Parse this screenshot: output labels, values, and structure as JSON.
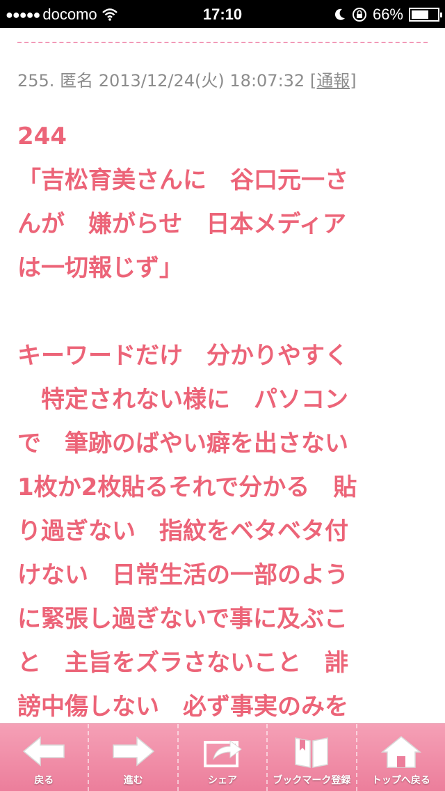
{
  "status_bar": {
    "signal": "●●●●●",
    "carrier": "docomo",
    "time": "17:10",
    "battery": "66%",
    "icons": [
      "wifi-icon",
      "moon-icon",
      "rotation-lock-icon",
      "battery-icon"
    ]
  },
  "post": {
    "number": "255.",
    "author": "匿名",
    "date": "2013/12/24(火) 18:07:32",
    "report_label": "[通報]",
    "lines": [
      "244",
      "「吉松育美さんに　谷口元一さ",
      "んが　嫌がらせ　日本メディア",
      "は一切報じず」",
      "",
      "キーワードだけ　分かりやすく",
      "　特定されない様に　パソコン",
      "で　筆跡のばやい癖を出さない",
      "1枚か2枚貼るそれで分かる　貼",
      "り過ぎない　指紋をベタベタ付",
      "けない　日常生活の一部のよう",
      "に緊張し過ぎないで事に及ぶこ",
      "と　主旨をズラさないこと　誹",
      "謗中傷しない　必ず事実のみを"
    ]
  },
  "toolbar": {
    "back": "戻る",
    "forward": "進む",
    "share": "シェア",
    "bookmark": "ブックマーク登録",
    "top": "トップへ戻る"
  },
  "colors": {
    "accent": "#ec6478",
    "toolbar": "#f29ab8"
  }
}
